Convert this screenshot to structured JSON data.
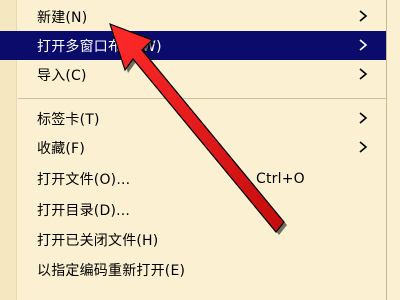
{
  "menu": {
    "items": [
      {
        "label": "新建(N)",
        "shortcut": "",
        "submenu": true,
        "highlighted": false
      },
      {
        "label": "打开多窗口布局(W)",
        "shortcut": "",
        "submenu": true,
        "highlighted": true
      },
      {
        "label": "导入(C)",
        "shortcut": "",
        "submenu": true,
        "highlighted": false
      },
      {
        "label": "标签卡(T)",
        "shortcut": "",
        "submenu": true,
        "highlighted": false
      },
      {
        "label": "收藏(F)",
        "shortcut": "",
        "submenu": true,
        "highlighted": false
      },
      {
        "label": "打开文件(O)...",
        "shortcut": "Ctrl+O",
        "submenu": false,
        "highlighted": false
      },
      {
        "label": "打开目录(D)...",
        "shortcut": "",
        "submenu": false,
        "highlighted": false
      },
      {
        "label": "打开已关闭文件(H)",
        "shortcut": "",
        "submenu": false,
        "highlighted": false
      },
      {
        "label": "以指定编码重新打开(E)",
        "shortcut": "",
        "submenu": false,
        "highlighted": false
      }
    ]
  },
  "colors": {
    "menu_background": "#fbf1d2",
    "highlight_background": "#0b0b6b",
    "highlight_text": "#ffffff",
    "annotation_arrow": "#e01818"
  },
  "annotation": {
    "type": "arrow",
    "icon": "red-arrow-icon"
  }
}
